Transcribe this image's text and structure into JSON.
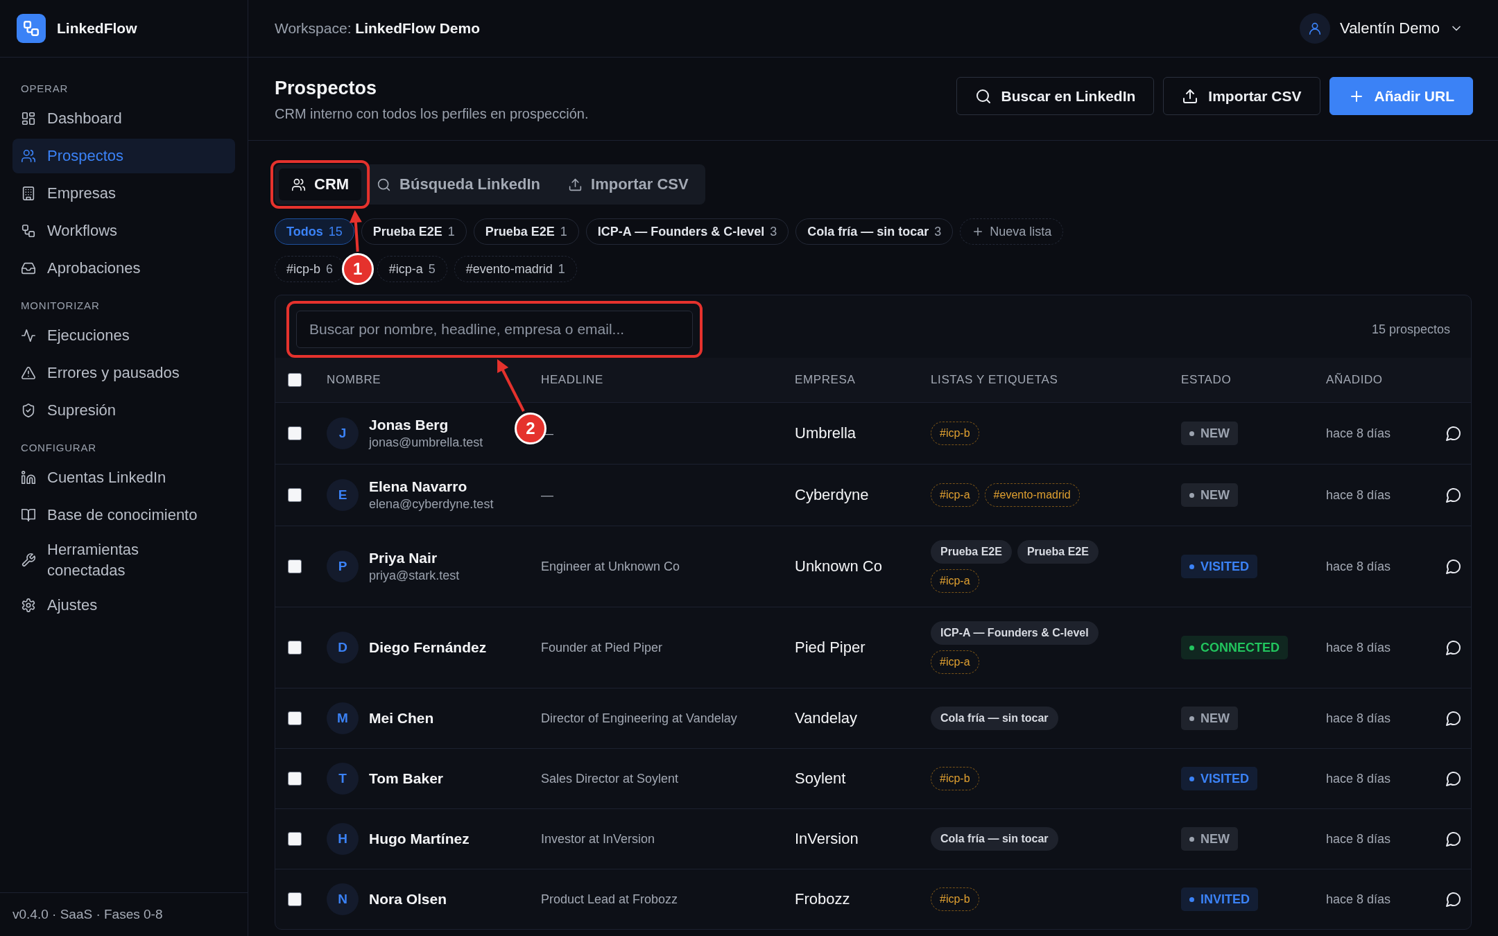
{
  "sidebar": {
    "brand": "LinkedFlow",
    "sections": [
      {
        "title": "OPERAR",
        "items": [
          {
            "label": "Dashboard",
            "selected": false
          },
          {
            "label": "Prospectos",
            "selected": true
          },
          {
            "label": "Empresas",
            "selected": false
          },
          {
            "label": "Workflows",
            "selected": false
          },
          {
            "label": "Aprobaciones",
            "selected": false
          }
        ]
      },
      {
        "title": "MONITORIZAR",
        "items": [
          {
            "label": "Ejecuciones",
            "selected": false
          },
          {
            "label": "Errores y pausados",
            "selected": false
          },
          {
            "label": "Supresión",
            "selected": false
          }
        ]
      },
      {
        "title": "CONFIGURAR",
        "items": [
          {
            "label": "Cuentas LinkedIn",
            "selected": false
          },
          {
            "label": "Base de conocimiento",
            "selected": false
          },
          {
            "label": "Herramientas conectadas",
            "selected": false
          },
          {
            "label": "Ajustes",
            "selected": false
          }
        ]
      }
    ],
    "footer": "v0.4.0 · SaaS · Fases 0-8"
  },
  "topbar": {
    "workspace_label": "Workspace:",
    "workspace_name": "LinkedFlow Demo",
    "user": "Valentín Demo"
  },
  "page": {
    "title": "Prospectos",
    "subtitle": "CRM interno con todos los perfiles en prospección.",
    "actions": [
      {
        "label": "Buscar en LinkedIn",
        "primary": false
      },
      {
        "label": "Importar CSV",
        "primary": false
      },
      {
        "label": "Añadir URL",
        "primary": true
      }
    ]
  },
  "tabs": [
    {
      "label": "CRM",
      "selected": true
    },
    {
      "label": "Búsqueda LinkedIn",
      "selected": false
    },
    {
      "label": "Importar CSV",
      "selected": false
    }
  ],
  "lists": [
    {
      "label": "Todos",
      "count": "15",
      "selected": true
    },
    {
      "label": "Prueba E2E",
      "count": "1",
      "selected": false
    },
    {
      "label": "Prueba E2E",
      "count": "1",
      "selected": false
    },
    {
      "label": "ICP-A — Founders & C-level",
      "count": "3",
      "selected": false
    },
    {
      "label": "Cola fría — sin tocar",
      "count": "3",
      "selected": false
    }
  ],
  "new_list": "Nueva lista",
  "tags": [
    {
      "label": "#icp-b",
      "count": "6",
      "selected": false
    },
    {
      "label": "#icp-a",
      "count": "5",
      "selected": false
    },
    {
      "label": "#evento-madrid",
      "count": "1",
      "selected": false
    }
  ],
  "table": {
    "search": {
      "placeholder": "Buscar por nombre, headline, empresa o email..."
    },
    "count": "15 prospectos",
    "select_all_checked": false,
    "columns": [
      "NOMBRE",
      "HEADLINE",
      "EMPRESA",
      "LISTAS Y ETIQUETAS",
      "ESTADO",
      "AÑADIDO"
    ],
    "rows": [
      {
        "checked": false,
        "initial": "J",
        "name": "Jonas Berg",
        "email": "jonas@umbrella.test",
        "headline": "—",
        "company": "Umbrella",
        "labels": [
          {
            "text": "#icp-b",
            "kind": "tag"
          }
        ],
        "status": {
          "label": "NEW",
          "color": "#9ca3af"
        },
        "added": "hace 8 días"
      },
      {
        "checked": false,
        "initial": "E",
        "name": "Elena Navarro",
        "email": "elena@cyberdyne.test",
        "headline": "—",
        "company": "Cyberdyne",
        "labels": [
          {
            "text": "#icp-a",
            "kind": "tag"
          },
          {
            "text": "#evento-madrid",
            "kind": "tag"
          }
        ],
        "status": {
          "label": "NEW",
          "color": "#9ca3af"
        },
        "added": "hace 8 días"
      },
      {
        "checked": false,
        "initial": "P",
        "name": "Priya Nair",
        "email": "priya@stark.test",
        "headline": "Engineer at Unknown Co",
        "company": "Unknown Co",
        "labels": [
          {
            "text": "Prueba E2E",
            "kind": "list"
          },
          {
            "text": "Prueba E2E",
            "kind": "list"
          },
          {
            "text": "#icp-a",
            "kind": "tag"
          }
        ],
        "status": {
          "label": "VISITED",
          "color": "#3b82f6"
        },
        "added": "hace 8 días"
      },
      {
        "checked": false,
        "initial": "D",
        "name": "Diego Fernández",
        "headline": "Founder at Pied Piper",
        "company": "Pied Piper",
        "labels": [
          {
            "text": "ICP-A — Founders & C-level",
            "kind": "list"
          },
          {
            "text": "#icp-a",
            "kind": "tag"
          }
        ],
        "status": {
          "label": "CONNECTED",
          "color": "#22c55e"
        },
        "added": "hace 8 días"
      },
      {
        "checked": false,
        "initial": "M",
        "name": "Mei Chen",
        "headline": "Director of Engineering at Vandelay",
        "company": "Vandelay",
        "labels": [
          {
            "text": "Cola fría — sin tocar",
            "kind": "list"
          }
        ],
        "status": {
          "label": "NEW",
          "color": "#9ca3af"
        },
        "added": "hace 8 días"
      },
      {
        "checked": false,
        "initial": "T",
        "name": "Tom Baker",
        "headline": "Sales Director at Soylent",
        "company": "Soylent",
        "labels": [
          {
            "text": "#icp-b",
            "kind": "tag"
          }
        ],
        "status": {
          "label": "VISITED",
          "color": "#3b82f6"
        },
        "added": "hace 8 días"
      },
      {
        "checked": false,
        "initial": "H",
        "name": "Hugo Martínez",
        "headline": "Investor at InVersion",
        "company": "InVersion",
        "labels": [
          {
            "text": "Cola fría — sin tocar",
            "kind": "list"
          }
        ],
        "status": {
          "label": "NEW",
          "color": "#9ca3af"
        },
        "added": "hace 8 días"
      },
      {
        "checked": false,
        "initial": "N",
        "name": "Nora Olsen",
        "headline": "Product Lead at Frobozz",
        "company": "Frobozz",
        "labels": [
          {
            "text": "#icp-b",
            "kind": "tag"
          }
        ],
        "status": {
          "label": "INVITED",
          "color": "#3b82f6"
        },
        "added": "hace 8 días"
      }
    ]
  },
  "annotations": [
    {
      "number": "1"
    },
    {
      "number": "2"
    }
  ]
}
